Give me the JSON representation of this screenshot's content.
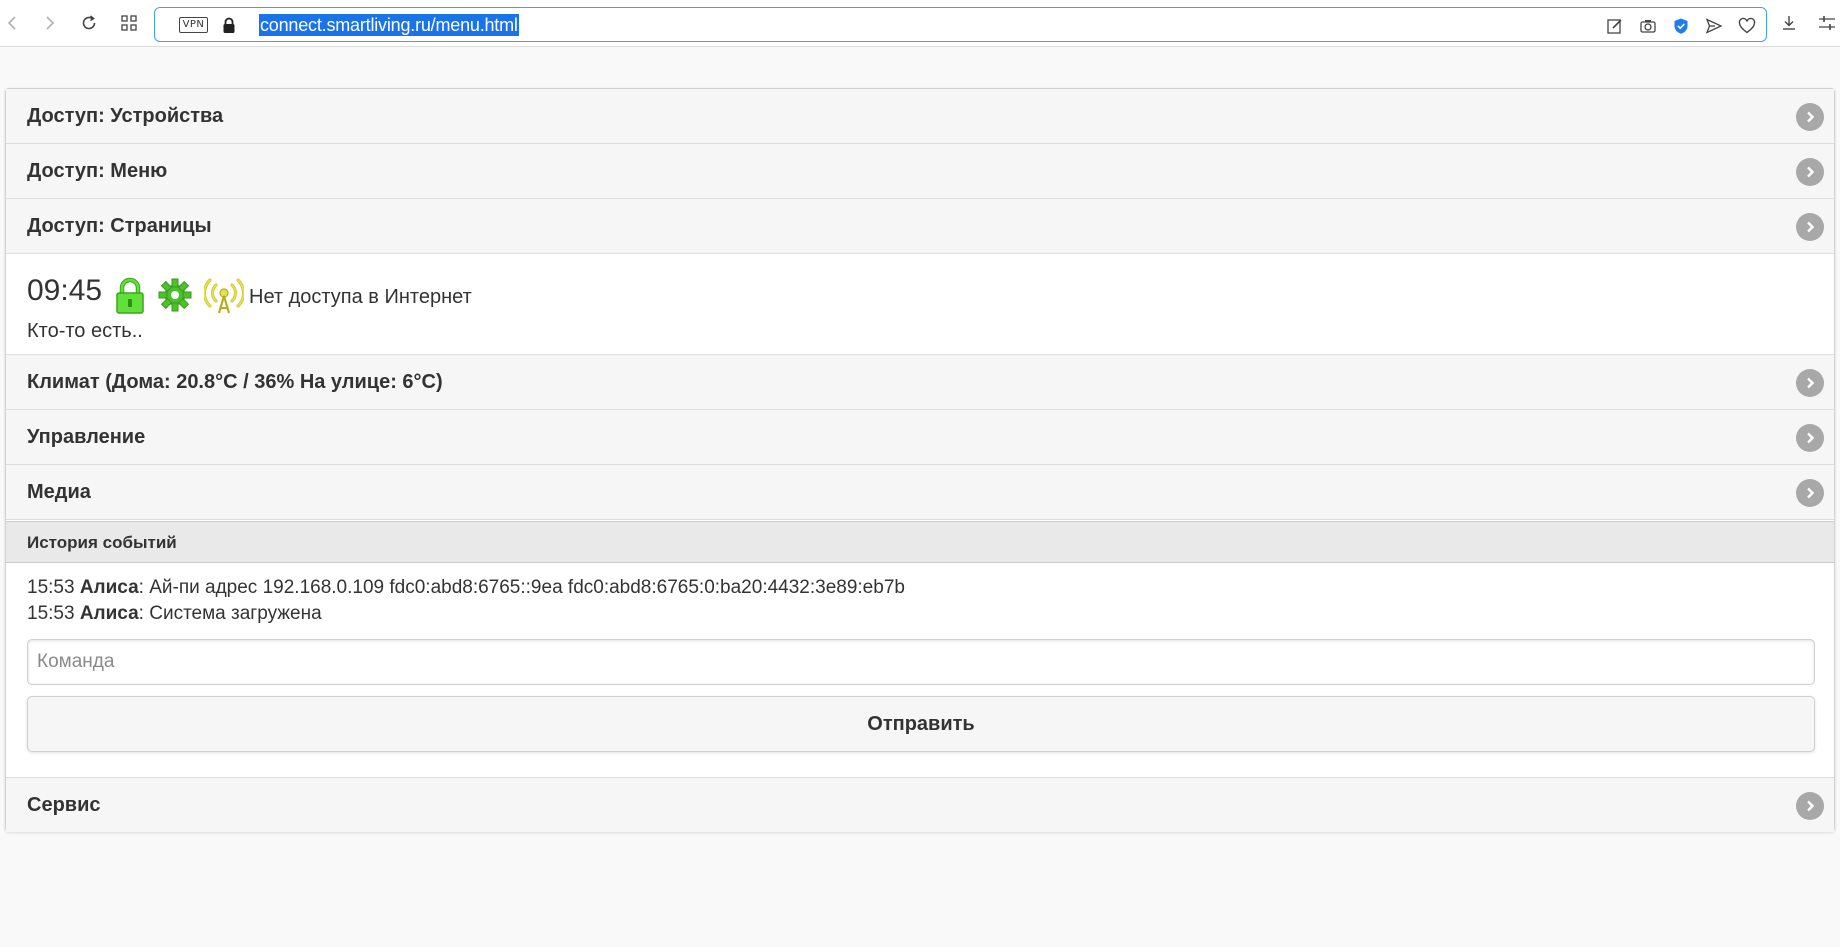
{
  "browser": {
    "url": "connect.smartliving.ru/menu.html",
    "vpn_label": "VPN"
  },
  "menu": {
    "access_devices": "Доступ: Устройства",
    "access_menu": "Доступ: Меню",
    "access_pages": "Доступ: Страницы",
    "climate": "Климат (Дома: 20.8°C / 36% На улице: 6°C)",
    "control": "Управление",
    "media": "Медиа",
    "service": "Сервис"
  },
  "status": {
    "time": "09:45",
    "network": "Нет доступа в Интернет",
    "presence": "Кто-то есть..",
    "colors": {
      "lock": "#5fe03b",
      "gear": "#4cc22a",
      "antenna": "#e8e24a"
    }
  },
  "history": {
    "title": "История событий",
    "entries": [
      {
        "time": "15:53",
        "author": "Алиса",
        "text": ": Ай-пи адрес 192.168.0.109 fdc0:abd8:6765::9ea fdc0:abd8:6765:0:ba20:4432:3e89:eb7b"
      },
      {
        "time": "15:53",
        "author": "Алиса",
        "text": ": Система загружена"
      }
    ],
    "command_placeholder": "Команда",
    "send_label": "Отправить"
  }
}
